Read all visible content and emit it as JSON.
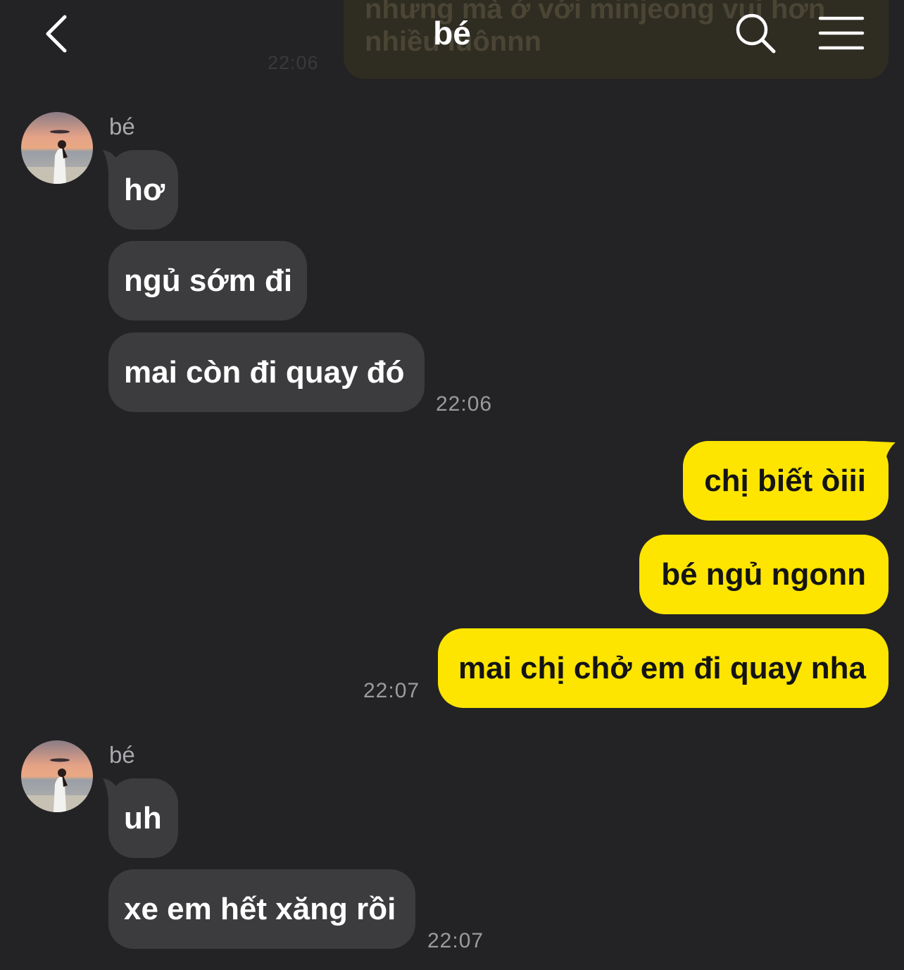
{
  "header": {
    "title": "bé",
    "back_icon": "chevron-left-icon",
    "search_icon": "search-icon",
    "menu_icon": "hamburger-menu-icon"
  },
  "faded_message": {
    "text": "nhưng mà ở với minjeong vui hơn\nnhiều luônnn",
    "time": "22:06"
  },
  "groups": [
    {
      "sender": "bé",
      "messages": [
        "hơ",
        "ngủ sớm đi",
        "mai còn đi quay đó"
      ],
      "time": "22:06"
    },
    {
      "messages": [
        "chị biết òiii",
        "bé ngủ ngonn",
        "mai chị chở em đi quay nha"
      ],
      "time": "22:07"
    },
    {
      "sender": "bé",
      "messages": [
        "uh",
        "xe em hết xăng rồi"
      ],
      "time": "22:07"
    }
  ],
  "colors": {
    "background": "#232325",
    "incoming_bubble": "#3c3c3f",
    "outgoing_bubble": "#fde500",
    "timestamp": "#9b9b9f"
  }
}
